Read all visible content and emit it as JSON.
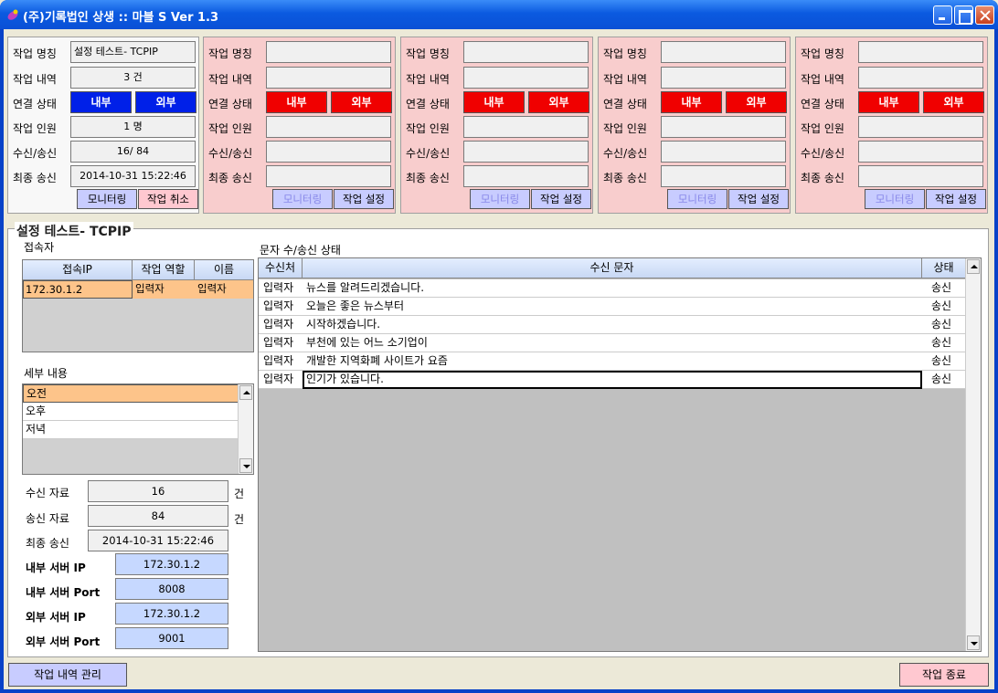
{
  "window": {
    "title": "(주)기록법인 상생 :: 마블 S  Ver 1.3"
  },
  "labels": {
    "name": "작업 명칭",
    "history": "작업 내역",
    "conn": "연결 상태",
    "members": "작업 인원",
    "rxtx": "수신/송신",
    "last": "최종 송신",
    "internal": "내부",
    "external": "외부",
    "monitor": "모니터링",
    "cancel": "작업 취소",
    "setup": "작업 설정"
  },
  "panel1": {
    "name": "설정 테스트- TCPIP",
    "history": "3 건",
    "members": "1 명",
    "rxtx": "16/ 84",
    "last": "2014-10-31 15:22:46"
  },
  "detail": {
    "title": "설정 테스트- TCPIP",
    "connected_title": "접속자",
    "conn_headers": [
      "접속IP",
      "작업 역할",
      "이름"
    ],
    "conn_rows": [
      [
        "172.30.1.2",
        "입력자",
        "입력자"
      ]
    ],
    "sub_title": "세부 내용",
    "sub_items": [
      "오전",
      "오후",
      "저녁"
    ],
    "rx_label": "수신 자료",
    "rx_value": "16",
    "tx_label": "송신 자료",
    "tx_value": "84",
    "unit": "건",
    "last_label": "최종 송신",
    "last_value": "2014-10-31 15:22:46",
    "in_ip_label": "내부 서버 IP",
    "in_ip": "172.30.1.2",
    "in_port_label": "내부 서버 Port",
    "in_port": "8008",
    "out_ip_label": "외부 서버 IP",
    "out_ip": "172.30.1.2",
    "out_port_label": "외부 서버 Port",
    "out_port": "9001",
    "msg_title": "문자 수/송신 상태",
    "msg_headers": [
      "수신처",
      "수신 문자",
      "상태"
    ],
    "msg_rows": [
      [
        "입력자",
        "뉴스를 알려드리겠습니다.",
        "송신"
      ],
      [
        "입력자",
        "오늘은 좋은 뉴스부터",
        "송신"
      ],
      [
        "입력자",
        "시작하겠습니다.",
        "송신"
      ],
      [
        "입력자",
        "부천에 있는 어느 소기업이",
        "송신"
      ],
      [
        "입력자",
        "개발한 지역화폐 사이트가 요즘",
        "송신"
      ],
      [
        "입력자",
        "인기가 있습니다.",
        "송신"
      ]
    ]
  },
  "bottom": {
    "manage": "작업 내역 관리",
    "exit": "작업 종료"
  },
  "colors": {
    "internal": "#0020E8",
    "external": "#F00000",
    "selection": "#FDC48A",
    "title_bar": "#0B5AE0"
  }
}
